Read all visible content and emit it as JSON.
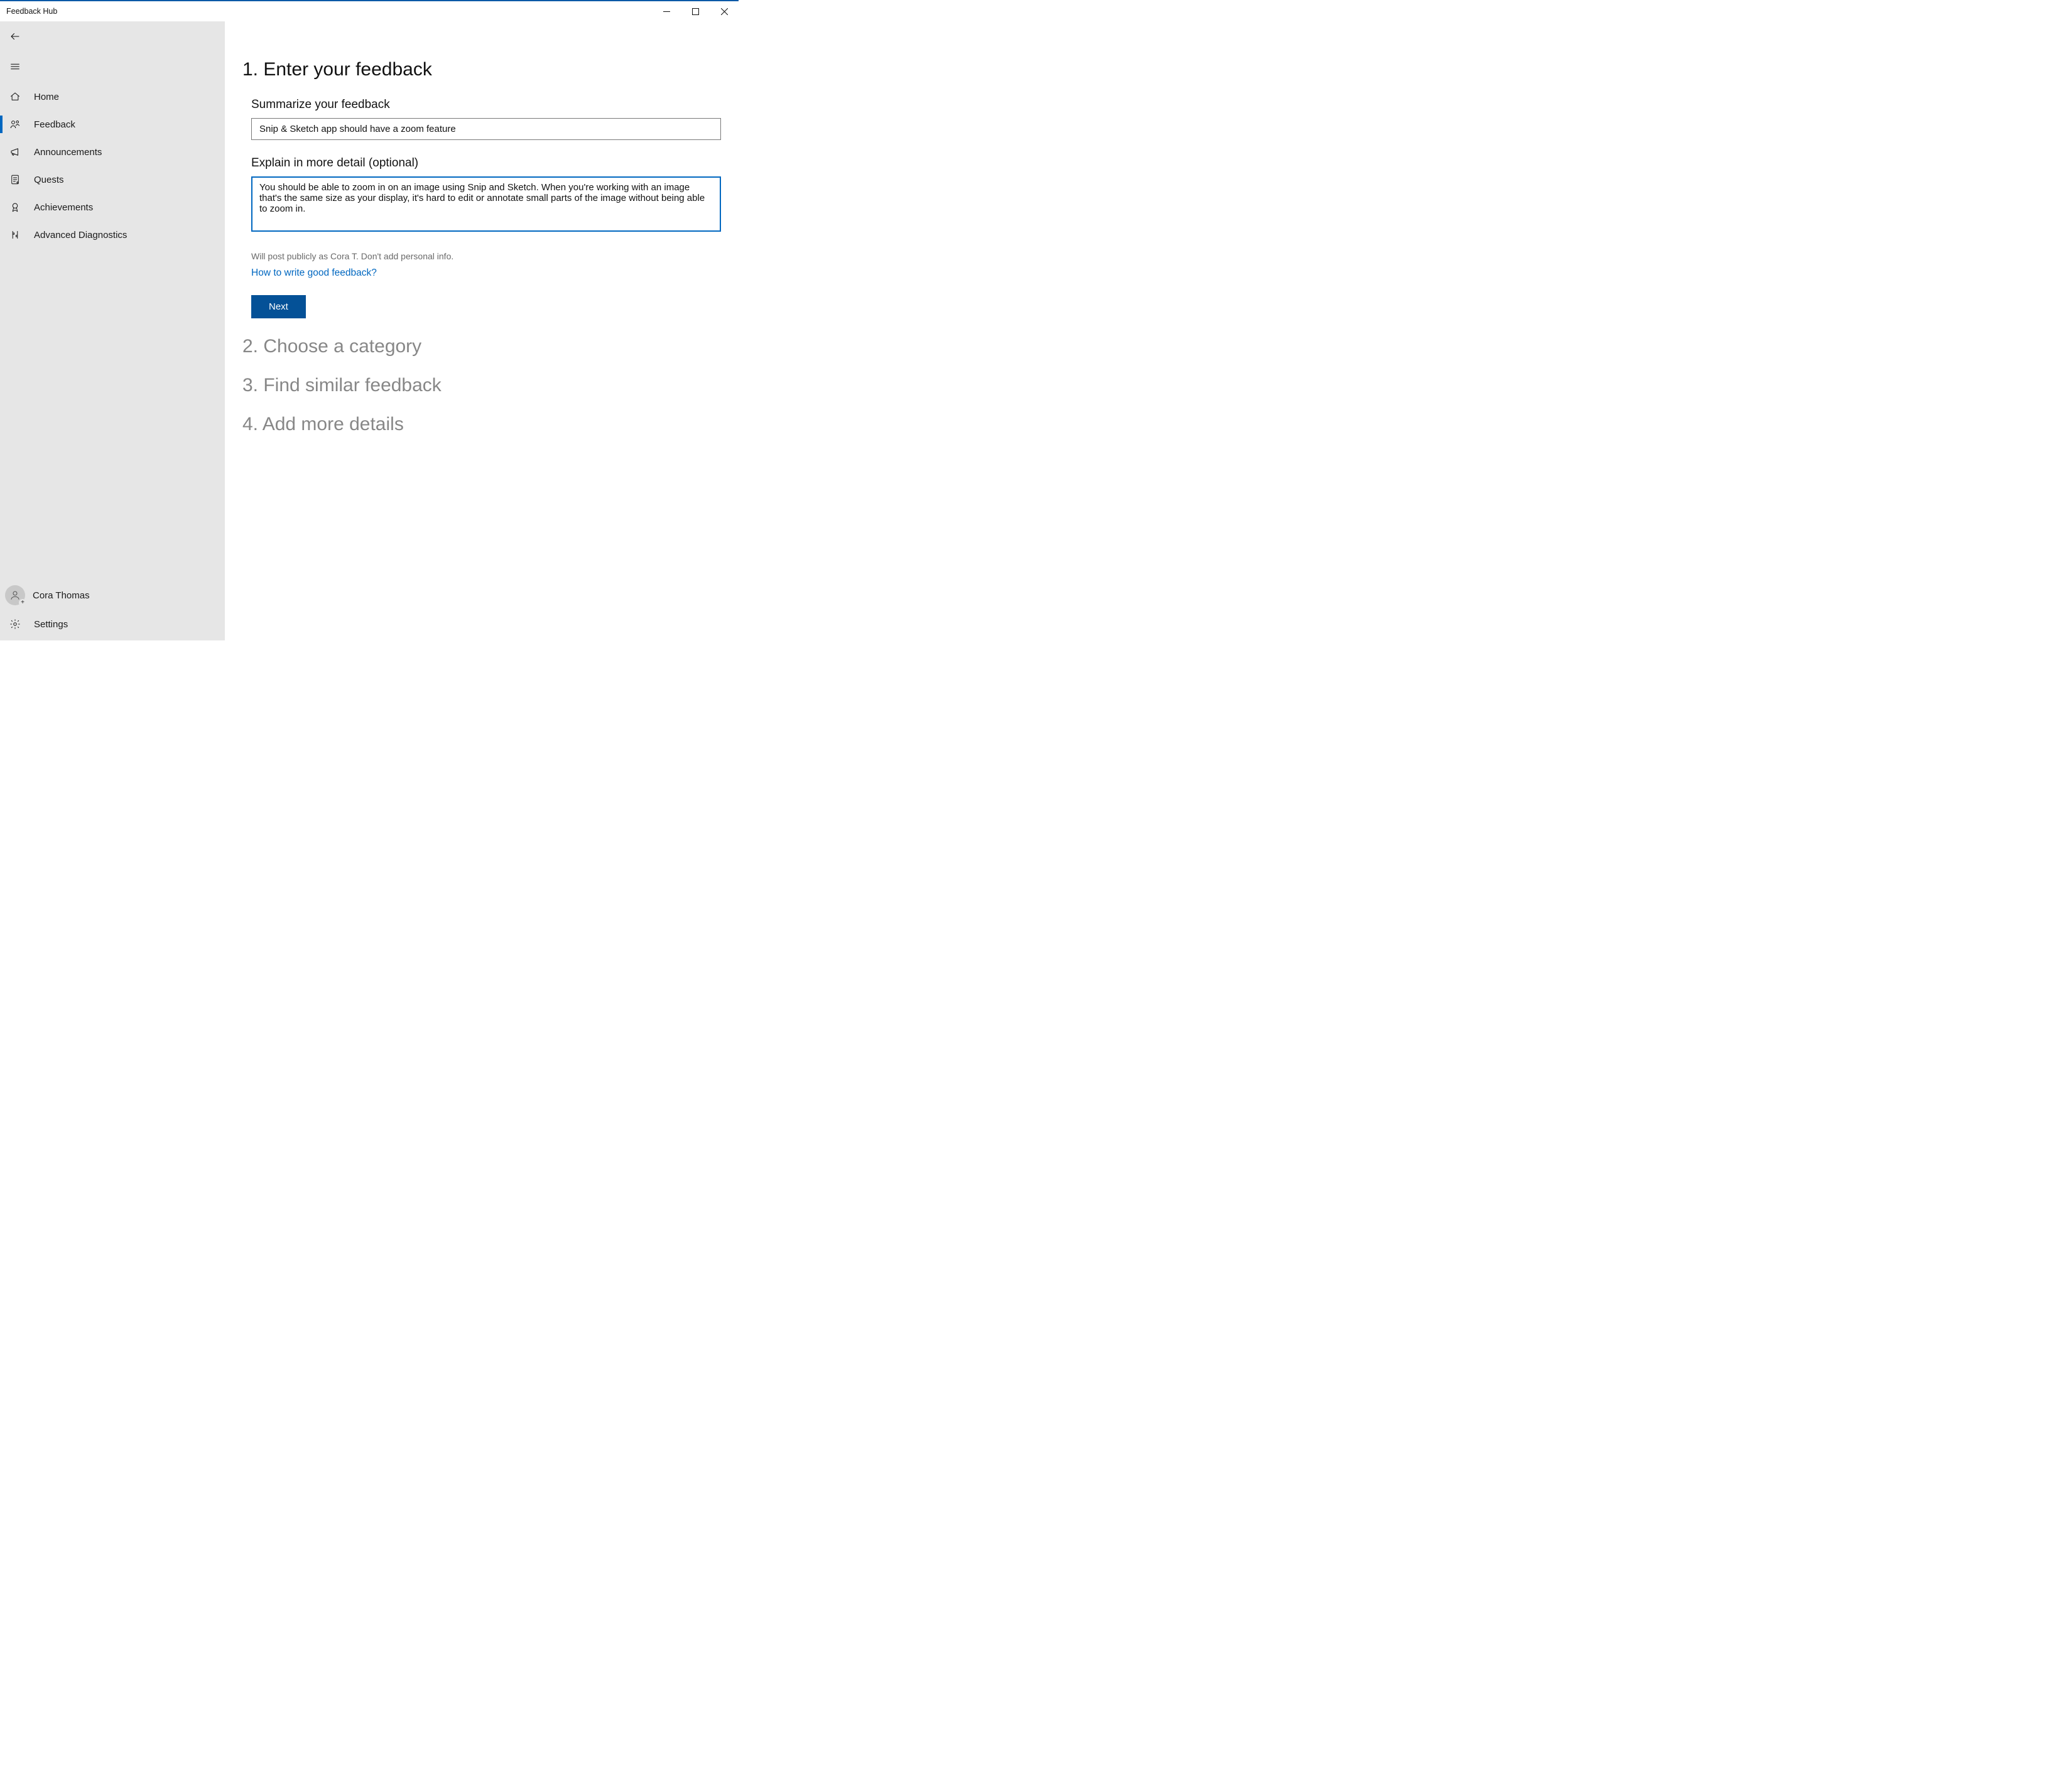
{
  "window": {
    "title": "Feedback Hub"
  },
  "sidebar": {
    "nav": [
      {
        "id": "home",
        "label": "Home",
        "icon": "home-icon",
        "active": false
      },
      {
        "id": "feedback",
        "label": "Feedback",
        "icon": "feedback-icon",
        "active": true
      },
      {
        "id": "announcements",
        "label": "Announcements",
        "icon": "megaphone-icon",
        "active": false
      },
      {
        "id": "quests",
        "label": "Quests",
        "icon": "quests-icon",
        "active": false
      },
      {
        "id": "achievements",
        "label": "Achievements",
        "icon": "award-icon",
        "active": false
      },
      {
        "id": "advanced",
        "label": "Advanced Diagnostics",
        "icon": "diagnostics-icon",
        "active": false
      }
    ],
    "user": {
      "display_name": "Cora Thomas"
    },
    "settings_label": "Settings"
  },
  "main": {
    "steps": {
      "step1": {
        "title": "1. Enter your feedback",
        "summary_label": "Summarize your feedback",
        "summary_value": "Snip & Sketch app should have a zoom feature",
        "detail_label": "Explain in more detail (optional)",
        "detail_value": "You should be able to zoom in on an image using Snip and Sketch. When you're working with an image that's the same size as your display, it's hard to edit or annotate small parts of the image without being able to zoom in.",
        "privacy_note": "Will post publicly as Cora T. Don't add personal info.",
        "help_link": "How to write good feedback?",
        "next_label": "Next"
      },
      "step2_title": "2. Choose a category",
      "step3_title": "3. Find similar feedback",
      "step4_title": "4. Add more details"
    }
  }
}
